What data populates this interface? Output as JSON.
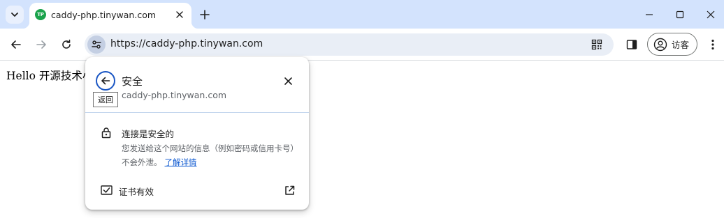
{
  "tabstrip": {
    "search_icon": "chevron-down-icon",
    "tab": {
      "favicon_text": "TP",
      "favicon_color": "#1ba34c",
      "title": "caddy-php.tinywan.com"
    },
    "new_tab_icon": "plus-icon"
  },
  "window_controls": [
    "minimize-icon",
    "maximize-icon",
    "close-icon"
  ],
  "toolbar": {
    "url": "https://caddy-php.tinywan.com",
    "profile_label": "访客"
  },
  "page": {
    "text": "Hello 开源技术小"
  },
  "popup": {
    "title": "安全",
    "back_tooltip": "返回",
    "host": "caddy-php.tinywan.com",
    "secure_title": "连接是安全的",
    "secure_desc": "您发送给这个网站的信息（例如密码或信用卡号）不会外泄。",
    "learn_more": "了解详情",
    "cert_label": "证书有效"
  },
  "colors": {
    "tabstrip_bg": "#d3e3fd",
    "omnibox_bg": "#e9eef6",
    "accent": "#0b57d0"
  }
}
